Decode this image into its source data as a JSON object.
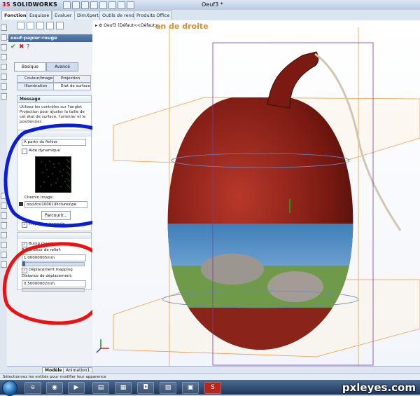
{
  "app": {
    "logo_prefix": "3S",
    "logo_name": "SOLIDWORKS",
    "document_title": "Oeuf3 *"
  },
  "command_tabs": [
    "Fonctions",
    "Esquisse",
    "Evaluer",
    "DimXpert",
    "Outils de rendu",
    "Produits Office"
  ],
  "feature_tree": {
    "root": "Oeuf3",
    "config": "(Défaut<<Défaut>..."
  },
  "viewport": {
    "view_label": "an de droite"
  },
  "property_manager": {
    "title": "oeuf-papier-rouge",
    "mode_buttons": [
      "Basique",
      "Avancé"
    ],
    "active_mode": "Avancé",
    "subtabs_row1": [
      "Couleur/Image",
      "Projection"
    ],
    "subtabs_row2": [
      "Illumination",
      "Etat de surface"
    ],
    "message": {
      "header": "Message",
      "text": "Utilisez les contrôles sur l'onglet Projection pour ajuster la taille de cet état de surface, l'orienter et le positionner."
    },
    "surface_group": {
      "source_label": "A partir du fichier",
      "dynamic_help_label": "Aide dynamique",
      "image_path_label": "Chemin image:",
      "image_path_value": "ooo\\fcsl10061\\Pictures\\pe",
      "browse_label": "Parcourir...",
      "normal_projection_label": "Projection normale",
      "normal_projection_checked": true
    },
    "bump": {
      "bump_label": "Bump mapping",
      "bump_checked": true,
      "depth_label": "Profondeur de relief:",
      "depth_value": "1.00000005mm",
      "displacement_label": "Déplacement mapping",
      "displacement_checked": true,
      "distance_label": "Distance de déplacement:",
      "distance_value": "0.50000002mm"
    }
  },
  "bottom_tabs": [
    "Modèle",
    "Animation1"
  ],
  "status_text": "Sélectionnez les entités pour modifier leur apparence",
  "watermark": "pxleyes.com",
  "colors": {
    "accent": "#3f649a",
    "egg_red": "#7a1a12",
    "highlight_orange": "#e8a040",
    "annotation_blue": "#0a1ed8",
    "annotation_red": "#ee1111"
  }
}
